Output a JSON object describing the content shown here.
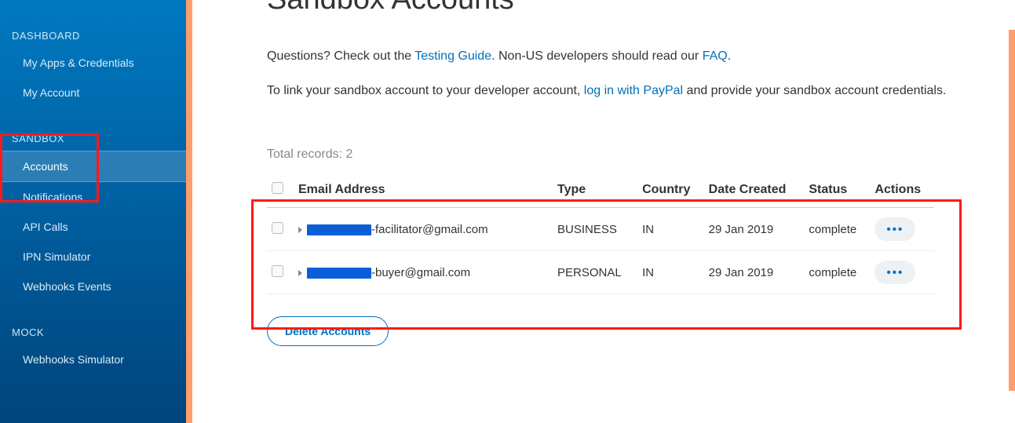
{
  "sidebar": {
    "sections": [
      {
        "title": "DASHBOARD",
        "items": [
          "My Apps & Credentials",
          "My Account"
        ]
      },
      {
        "title": "SANDBOX",
        "items": [
          "Accounts",
          "Notifications",
          "API Calls",
          "IPN Simulator",
          "Webhooks Events"
        ],
        "activeIndex": 0
      },
      {
        "title": "MOCK",
        "items": [
          "Webhooks Simulator"
        ]
      }
    ]
  },
  "main": {
    "page_title": "Sandbox Accounts",
    "intro": {
      "p1_a": "Questions? Check out the ",
      "p1_link1": "Testing Guide",
      "p1_b": ". Non-US developers should read our ",
      "p1_link2": "FAQ",
      "p1_c": ".",
      "p2_a": "To link your sandbox account to your developer account, ",
      "p2_link": "log in with PayPal",
      "p2_b": " and provide your sandbox account credentials."
    },
    "total_label": "Total records: ",
    "total_value": "2",
    "table": {
      "headers": [
        "Email Address",
        "Type",
        "Country",
        "Date Created",
        "Status",
        "Actions"
      ],
      "rows": [
        {
          "email_suffix": "-facilitator@gmail.com",
          "redact_width": 82,
          "type": "BUSINESS",
          "country": "IN",
          "date_created": "29 Jan 2019",
          "status": "complete"
        },
        {
          "email_suffix": "-buyer@gmail.com",
          "redact_width": 82,
          "type": "PERSONAL",
          "country": "IN",
          "date_created": "29 Jan 2019",
          "status": "complete"
        }
      ]
    },
    "delete_button": "Delete Accounts"
  }
}
